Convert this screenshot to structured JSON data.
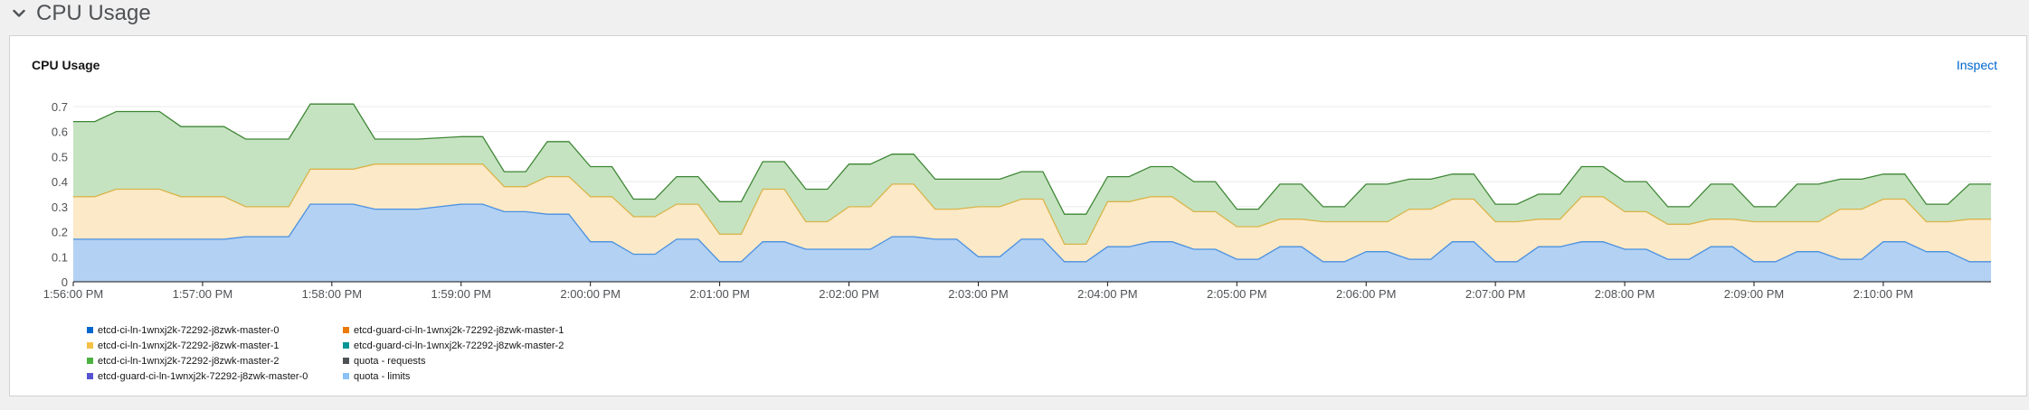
{
  "section": {
    "title": "CPU Usage"
  },
  "card": {
    "title": "CPU Usage",
    "inspect_label": "Inspect"
  },
  "colors": {
    "master0": "#4a90e2",
    "master0_fill": "#b3d1f2",
    "master1": "#d9b44a",
    "master1_fill": "#fbe9c7",
    "master2": "#3e8635",
    "master2_fill": "#c5e3c1",
    "axis": "#151515",
    "grid": "#e8e8e8"
  },
  "legend": [
    {
      "label": "etcd-ci-ln-1wnxj2k-72292-j8zwk-master-0",
      "color": "#06c"
    },
    {
      "label": "etcd-guard-ci-ln-1wnxj2k-72292-j8zwk-master-1",
      "color": "#ec7a08"
    },
    {
      "label": "etcd-ci-ln-1wnxj2k-72292-j8zwk-master-1",
      "color": "#f4c145"
    },
    {
      "label": "etcd-guard-ci-ln-1wnxj2k-72292-j8zwk-master-2",
      "color": "#009596"
    },
    {
      "label": "etcd-ci-ln-1wnxj2k-72292-j8zwk-master-2",
      "color": "#4cb140"
    },
    {
      "label": "quota - requests",
      "color": "#4f5255"
    },
    {
      "label": "etcd-guard-ci-ln-1wnxj2k-72292-j8zwk-master-0",
      "color": "#5752d1"
    },
    {
      "label": "quota - limits",
      "color": "#8bc1f7"
    }
  ],
  "chart_data": {
    "type": "area",
    "stacked": true,
    "title": "CPU Usage",
    "xlabel": "",
    "ylabel": "",
    "ylim": [
      0,
      0.7
    ],
    "yticks": [
      "0",
      "0.1",
      "0.2",
      "0.3",
      "0.4",
      "0.5",
      "0.6",
      "0.7"
    ],
    "x_tick_labels": [
      "1:56:00 PM",
      "1:57:00 PM",
      "1:58:00 PM",
      "1:59:00 PM",
      "2:00:00 PM",
      "2:01:00 PM",
      "2:02:00 PM",
      "2:03:00 PM",
      "2:04:00 PM",
      "2:05:00 PM",
      "2:06:00 PM",
      "2:07:00 PM",
      "2:08:00 PM",
      "2:09:00 PM",
      "2:10:00 PM"
    ],
    "x_tick_times": [
      "13:56:00",
      "13:57:00",
      "13:58:00",
      "13:59:00",
      "14:00:00",
      "14:01:00",
      "14:02:00",
      "14:03:00",
      "14:04:00",
      "14:05:00",
      "14:06:00",
      "14:07:00",
      "14:08:00",
      "14:09:00",
      "14:10:00"
    ],
    "x_range": [
      "13:56:00",
      "14:10:50"
    ],
    "x": [
      "13:56:00",
      "13:56:10",
      "13:56:20",
      "13:56:40",
      "13:56:50",
      "13:57:10",
      "13:57:20",
      "13:57:40",
      "13:57:50",
      "13:58:10",
      "13:58:20",
      "13:58:40",
      "13:59:00",
      "13:59:10",
      "13:59:20",
      "13:59:30",
      "13:59:40",
      "13:59:50",
      "14:00:00",
      "14:00:10",
      "14:00:20",
      "14:00:30",
      "14:00:40",
      "14:00:50",
      "14:01:00",
      "14:01:10",
      "14:01:20",
      "14:01:30",
      "14:01:40",
      "14:01:50",
      "14:02:00",
      "14:02:10",
      "14:02:20",
      "14:02:30",
      "14:02:40",
      "14:02:50",
      "14:03:00",
      "14:03:10",
      "14:03:20",
      "14:03:30",
      "14:03:40",
      "14:03:50",
      "14:04:00",
      "14:04:10",
      "14:04:20",
      "14:04:30",
      "14:04:40",
      "14:04:50",
      "14:05:00",
      "14:05:10",
      "14:05:20",
      "14:05:30",
      "14:05:40",
      "14:05:50",
      "14:06:00",
      "14:06:10",
      "14:06:20",
      "14:06:30",
      "14:06:40",
      "14:06:50",
      "14:07:00",
      "14:07:10",
      "14:07:20",
      "14:07:30",
      "14:07:40",
      "14:07:50",
      "14:08:00",
      "14:08:10",
      "14:08:20",
      "14:08:30",
      "14:08:40",
      "14:08:50",
      "14:09:00",
      "14:09:10",
      "14:09:20",
      "14:09:30",
      "14:09:40",
      "14:09:50",
      "14:10:00",
      "14:10:10",
      "14:10:20",
      "14:10:30",
      "14:10:40",
      "14:10:50"
    ],
    "series": [
      {
        "name": "etcd-ci-ln-1wnxj2k-72292-j8zwk-master-0",
        "values": [
          0.17,
          0.17,
          0.17,
          0.17,
          0.17,
          0.17,
          0.18,
          0.18,
          0.31,
          0.31,
          0.29,
          0.29,
          0.31,
          0.31,
          0.28,
          0.28,
          0.27,
          0.27,
          0.16,
          0.16,
          0.11,
          0.11,
          0.17,
          0.17,
          0.08,
          0.08,
          0.16,
          0.16,
          0.13,
          0.13,
          0.13,
          0.13,
          0.18,
          0.18,
          0.17,
          0.17,
          0.1,
          0.1,
          0.17,
          0.17,
          0.08,
          0.08,
          0.14,
          0.14,
          0.16,
          0.16,
          0.13,
          0.13,
          0.09,
          0.09,
          0.14,
          0.14,
          0.08,
          0.08,
          0.12,
          0.12,
          0.09,
          0.09,
          0.16,
          0.16,
          0.08,
          0.08,
          0.14,
          0.14,
          0.16,
          0.16,
          0.13,
          0.13,
          0.09,
          0.09,
          0.14,
          0.14,
          0.08,
          0.08,
          0.12,
          0.12,
          0.09,
          0.09,
          0.16,
          0.16,
          0.12,
          0.12,
          0.08,
          0.08
        ]
      },
      {
        "name": "etcd-ci-ln-1wnxj2k-72292-j8zwk-master-1",
        "values": [
          0.17,
          0.17,
          0.2,
          0.2,
          0.17,
          0.17,
          0.12,
          0.12,
          0.14,
          0.14,
          0.18,
          0.18,
          0.16,
          0.16,
          0.1,
          0.1,
          0.15,
          0.15,
          0.18,
          0.18,
          0.15,
          0.15,
          0.14,
          0.14,
          0.11,
          0.11,
          0.21,
          0.21,
          0.11,
          0.11,
          0.17,
          0.17,
          0.21,
          0.21,
          0.12,
          0.12,
          0.2,
          0.2,
          0.16,
          0.16,
          0.07,
          0.07,
          0.18,
          0.18,
          0.18,
          0.18,
          0.15,
          0.15,
          0.13,
          0.13,
          0.11,
          0.11,
          0.16,
          0.16,
          0.12,
          0.12,
          0.2,
          0.2,
          0.17,
          0.17,
          0.16,
          0.16,
          0.11,
          0.11,
          0.18,
          0.18,
          0.15,
          0.15,
          0.14,
          0.14,
          0.11,
          0.11,
          0.16,
          0.16,
          0.12,
          0.12,
          0.2,
          0.2,
          0.17,
          0.17,
          0.12,
          0.12,
          0.17,
          0.17
        ]
      },
      {
        "name": "etcd-ci-ln-1wnxj2k-72292-j8zwk-master-2",
        "values": [
          0.3,
          0.3,
          0.31,
          0.31,
          0.28,
          0.28,
          0.27,
          0.27,
          0.26,
          0.26,
          0.1,
          0.1,
          0.11,
          0.11,
          0.06,
          0.06,
          0.14,
          0.14,
          0.12,
          0.12,
          0.07,
          0.07,
          0.11,
          0.11,
          0.13,
          0.13,
          0.11,
          0.11,
          0.13,
          0.13,
          0.17,
          0.17,
          0.12,
          0.12,
          0.12,
          0.12,
          0.11,
          0.11,
          0.11,
          0.11,
          0.12,
          0.12,
          0.1,
          0.1,
          0.12,
          0.12,
          0.12,
          0.12,
          0.07,
          0.07,
          0.14,
          0.14,
          0.06,
          0.06,
          0.15,
          0.15,
          0.12,
          0.12,
          0.1,
          0.1,
          0.07,
          0.07,
          0.1,
          0.1,
          0.12,
          0.12,
          0.12,
          0.12,
          0.07,
          0.07,
          0.14,
          0.14,
          0.06,
          0.06,
          0.15,
          0.15,
          0.12,
          0.12,
          0.1,
          0.1,
          0.07,
          0.07,
          0.14,
          0.14
        ]
      }
    ],
    "grid": true,
    "legend_position": "bottom-left"
  }
}
